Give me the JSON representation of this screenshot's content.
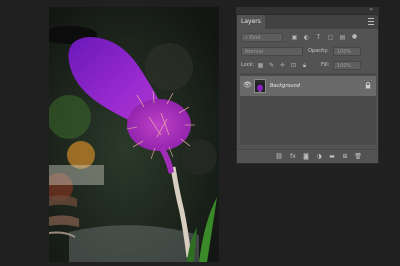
{
  "layers_panel": {
    "tab_title": "Layers",
    "tab_close": "×",
    "collapse_glyph": "»",
    "kind_filter_placeholder": "Kind",
    "blend_mode": "Normal",
    "opacity_label": "Opacity:",
    "opacity_value": "100%",
    "lock_label": "Lock:",
    "fill_label": "Fill:",
    "fill_value": "100%",
    "layers": [
      {
        "name": "Background",
        "visible": true,
        "locked": true
      }
    ],
    "footer_icons": [
      "link-icon",
      "fx-icon",
      "mask-icon",
      "adjustment-icon",
      "folder-icon",
      "new-layer-icon",
      "trash-icon"
    ]
  },
  "colors": {
    "panel_bg": "#535353",
    "selected_row": "#6a6a6a",
    "app_bg": "#202020",
    "flower_purple": "#8a1fc0",
    "stem": "#d9cfc0",
    "leaf_green": "#3a8a2a"
  }
}
